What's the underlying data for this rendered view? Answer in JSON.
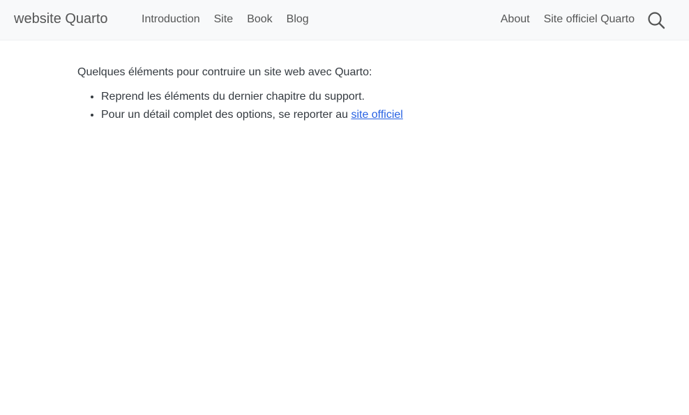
{
  "navbar": {
    "brand": "website Quarto",
    "left_items": [
      "Introduction",
      "Site",
      "Book",
      "Blog"
    ],
    "right_items": [
      "About",
      "Site officiel Quarto"
    ],
    "search_icon": "search-icon"
  },
  "main": {
    "intro": "Quelques éléments pour contruire un site web avec Quarto:",
    "bullet_1": "Reprend les éléments du dernier chapitre du support.",
    "bullet_2_prefix": "Pour un détail complet des options, se reporter au ",
    "bullet_2_link": "site officiel"
  },
  "colors": {
    "navbar_bg": "#f8f9fa",
    "text": "#343a40",
    "link": "#2761e3"
  }
}
